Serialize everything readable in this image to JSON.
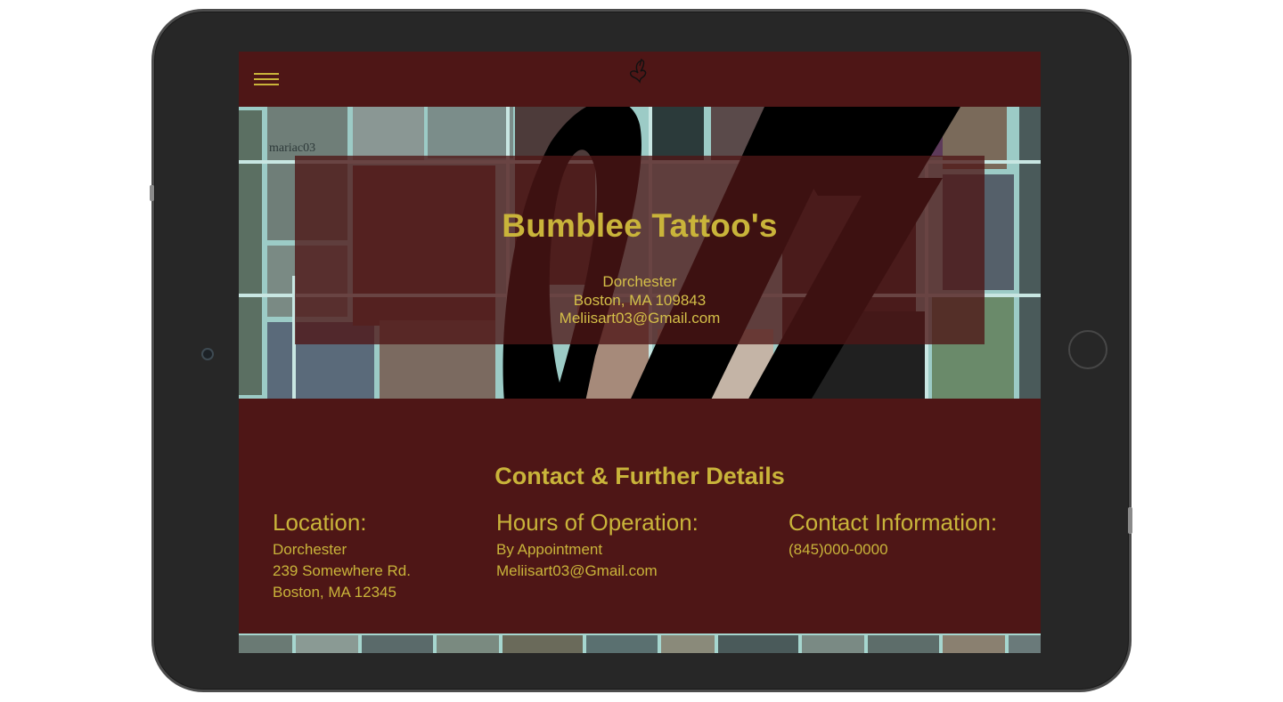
{
  "header": {
    "menu_icon": "hamburger-menu-icon",
    "logo_icon": "butterfly-logo-icon"
  },
  "hero": {
    "title": "Bumblee Tattoo's",
    "lines": [
      "Dorchester",
      "Boston, MA 109843",
      "Meliisart03@Gmail.com"
    ],
    "collage_caption": "mariac03"
  },
  "details": {
    "title": "Contact & Further Details",
    "columns": [
      {
        "heading": "Location:",
        "lines": [
          "Dorchester",
          "239 Somewhere Rd.",
          "Boston, MA 12345"
        ]
      },
      {
        "heading": "Hours of Operation:",
        "lines": [
          "By Appointment",
          "Meliisart03@Gmail.com"
        ]
      },
      {
        "heading": "Contact Information:",
        "lines": [
          "(845)000-0000"
        ]
      }
    ]
  },
  "colors": {
    "background": "#4e1616",
    "accent": "#c9b43a",
    "device_frame": "#272727"
  }
}
